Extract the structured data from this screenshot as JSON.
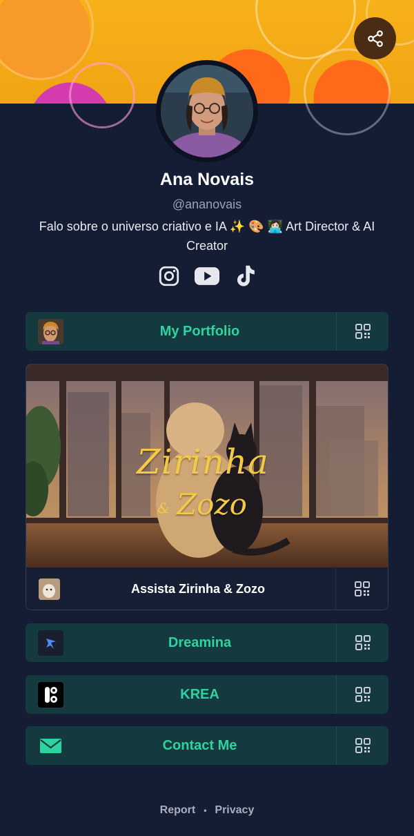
{
  "profile": {
    "name": "Ana Novais",
    "handle": "@ananovais",
    "bio": "Falo sobre o universo criativo e IA ✨ 🎨 👩🏻‍💻 Art Director & AI Creator"
  },
  "socials": [
    {
      "name": "instagram-icon"
    },
    {
      "name": "youtube-icon"
    },
    {
      "name": "tiktok-icon"
    }
  ],
  "links": {
    "portfolio": {
      "label": "My Portfolio"
    },
    "featured": {
      "caption": "Assista Zirinha & Zozo",
      "title_line1": "Zirinha",
      "title_amp": "&",
      "title_line2": "Zozo"
    },
    "dreamina": {
      "label": "Dreamina"
    },
    "krea": {
      "label": "KREA"
    },
    "contact": {
      "label": "Contact Me"
    }
  },
  "footer": {
    "report": "Report",
    "separator": "•",
    "privacy": "Privacy"
  },
  "colors": {
    "background": "#141d33",
    "button": "#143a3f",
    "accent": "#2fd39f",
    "banner": "#f7b11a"
  }
}
